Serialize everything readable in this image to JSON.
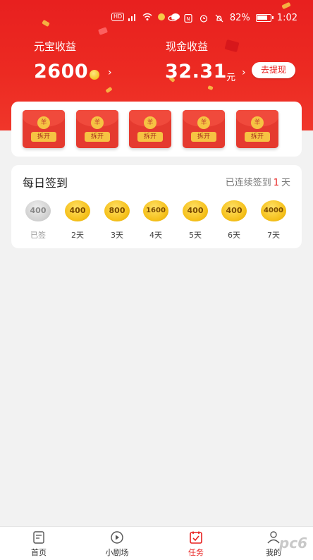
{
  "status_bar": {
    "battery": "82%",
    "time": "1:02",
    "hd": "HD"
  },
  "header": {
    "yuanbao_label": "元宝收益",
    "yuanbao_value": "2600",
    "cash_label": "现金收益",
    "cash_value": "32.31",
    "cash_unit": "元",
    "withdraw_label": "去提现",
    "chevron": "›"
  },
  "red_envelopes": [
    {
      "seal": "羊",
      "button": "拆开"
    },
    {
      "seal": "羊",
      "button": "拆开"
    },
    {
      "seal": "羊",
      "button": "拆开"
    },
    {
      "seal": "羊",
      "button": "拆开"
    },
    {
      "seal": "羊",
      "button": "拆开"
    }
  ],
  "checkin": {
    "title": "每日签到",
    "streak_prefix": "已连续签到",
    "streak_days": "1",
    "streak_suffix": "天",
    "days": [
      {
        "amount": "400",
        "label": "已签"
      },
      {
        "amount": "400",
        "label": "2天"
      },
      {
        "amount": "800",
        "label": "3天"
      },
      {
        "amount": "1600",
        "label": "4天"
      },
      {
        "amount": "400",
        "label": "5天"
      },
      {
        "amount": "400",
        "label": "6天"
      },
      {
        "amount": "4000",
        "label": "7天"
      }
    ]
  },
  "tabs": [
    {
      "label": "首页",
      "icon": "home-icon"
    },
    {
      "label": "小剧场",
      "icon": "play-icon"
    },
    {
      "label": "任务",
      "icon": "task-icon"
    },
    {
      "label": "我的",
      "icon": "user-icon"
    }
  ],
  "watermark": "pc6",
  "colors": {
    "brand_red": "#e8201f",
    "coin_gold": "#f6c21e",
    "envelope_red": "#e53a2f"
  }
}
